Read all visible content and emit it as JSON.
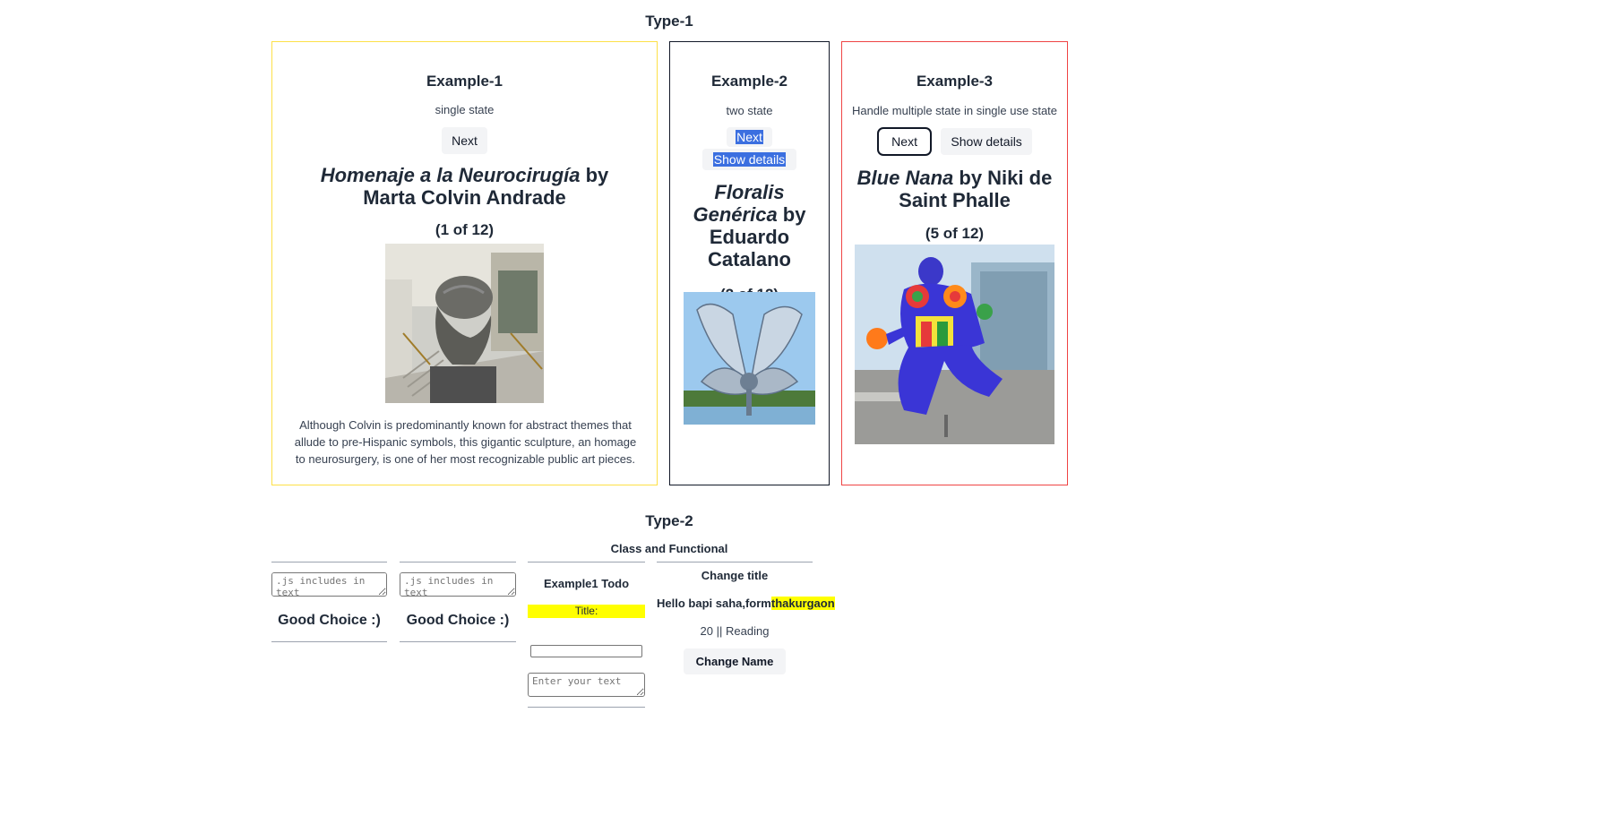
{
  "type1": {
    "heading": "Type-1",
    "example1": {
      "title": "Example-1",
      "subtitle": "single state",
      "next_label": "Next",
      "art_title_italic": "Homenaje a la Neurocirugía",
      "art_by": " by Marta Colvin Andrade",
      "count": "(1 of 12)",
      "image_icon": "sculpture-hands-brain-photo",
      "description": "Although Colvin is predominantly known for abstract themes that allude to pre-Hispanic symbols, this gigantic sculpture, an homage to neurosurgery, is one of her most recognizable public art pieces.",
      "border_color": "#fde047"
    },
    "example2": {
      "title": "Example-2",
      "subtitle": "two state",
      "next_label": "Next",
      "show_details_label": "Show details",
      "art_title_italic": "Floralis Genérica",
      "art_by": " by Eduardo Catalano",
      "count": "(2 of 12)",
      "image_icon": "metal-flower-sculpture-photo",
      "border_color": "#111827"
    },
    "example3": {
      "title": "Example-3",
      "subtitle": "Handle multiple state in single use state",
      "next_label": "Next",
      "show_details_label": "Show details",
      "art_title_italic": "Blue Nana",
      "art_by": " by Niki de Saint Phalle",
      "count": "(5 of 12)",
      "image_icon": "colorful-nana-sculpture-photo",
      "border_color": "#ef4444"
    }
  },
  "type2": {
    "heading": "Type-2",
    "subheading": "Class and Functional",
    "col1": {
      "placeholder": ".js includes in text",
      "message": "Good Choice :)"
    },
    "col2": {
      "placeholder": ".js includes in text",
      "message": "Good Choice :)"
    },
    "todo": {
      "title": "Example1 Todo",
      "title_label": "Title:",
      "text_placeholder": "Enter your text",
      "highlight": "#ffff00"
    },
    "change": {
      "title": "Change title",
      "greeting_prefix": "Hello bapi saha,form",
      "greeting_place": "thakurgaon",
      "age": "20",
      "separator": "||",
      "hobby": "Reading",
      "button_label": "Change Name"
    }
  }
}
